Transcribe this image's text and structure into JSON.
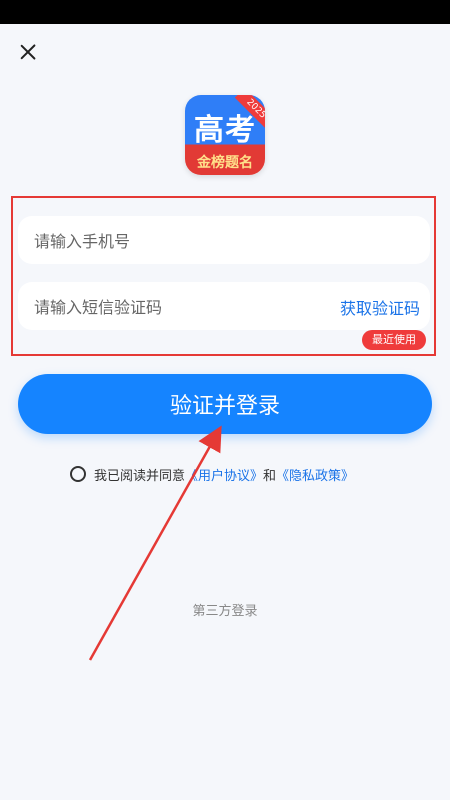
{
  "status_bar": {},
  "app": {
    "logo_main": "高考",
    "logo_sub": "金榜题名",
    "logo_year": "2025"
  },
  "form": {
    "phone_placeholder": "请输入手机号",
    "code_placeholder": "请输入短信验证码",
    "get_code_label": "获取验证码",
    "recent_badge": "最近使用",
    "login_label": "验证并登录"
  },
  "agreement": {
    "prefix": "我已阅读并同意",
    "user_agreement": "《用户协议》",
    "and": "和",
    "privacy_policy": "《隐私政策》"
  },
  "third_party": {
    "label": "第三方登录"
  },
  "colors": {
    "accent": "#1584ff",
    "highlight": "#e53935"
  }
}
